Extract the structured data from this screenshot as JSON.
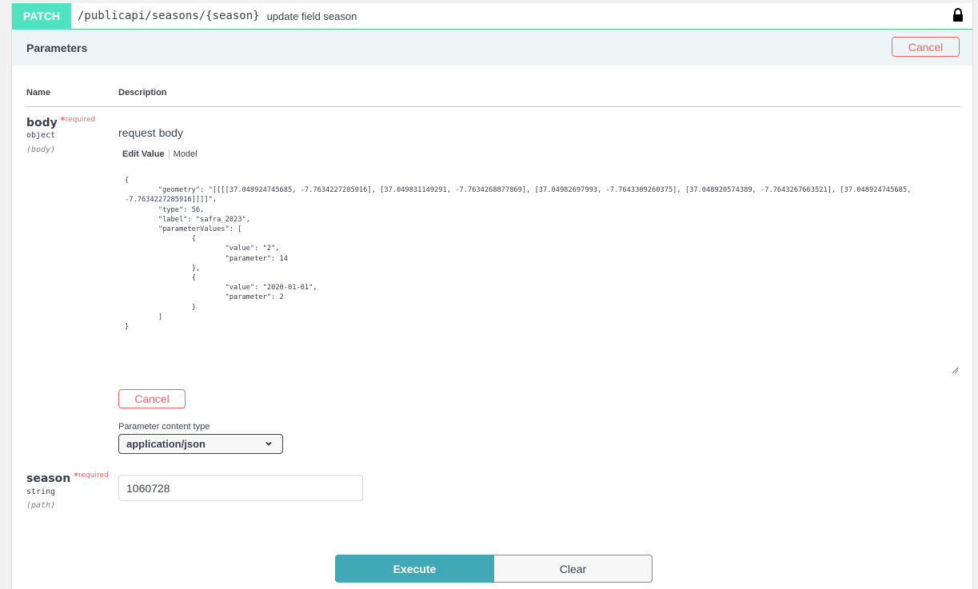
{
  "operation": {
    "method": "PATCH",
    "path": "/publicapi/seasons/{season}",
    "summary": "update field season",
    "lock_icon": "lock-icon"
  },
  "parameters": {
    "title": "Parameters",
    "cancel_label": "Cancel",
    "columns": {
      "name": "Name",
      "description": "Description"
    },
    "body": {
      "name": "body",
      "required_star": "*",
      "required_label": "required",
      "type": "object",
      "in": "(body)",
      "description": "request body",
      "tabs": [
        {
          "label": "Edit Value",
          "active": true
        },
        {
          "label": "Model",
          "active": false
        }
      ],
      "value": "{\n\t\"geometry\": \"[[[[37.048924745685, -7.7634227285916], [37.049831149291, -7.7634268877869], [37.04982697993, -7.7643309260375], [37.048920574389, -7.7643267663521], [37.048924745685, -7.7634227285916]]]]\",\n\t\"type\": 56,\n\t\"label\": \"safra_2023\",\n\t\"parameterValues\": [\n\t\t{\n\t\t\t\"value\": \"2\",\n\t\t\t\"parameter\": 14\n\t\t},\n\t\t{\n\t\t\t\"value\": \"2020-01-01\",\n\t\t\t\"parameter\": 2\n\t\t}\n\t]\n}",
      "cancel_label": "Cancel",
      "content_type_label": "Parameter content type",
      "content_type_value": "application/json"
    },
    "season": {
      "name": "season",
      "required_star": "*",
      "required_label": "required",
      "type": "string",
      "in": "(path)",
      "value": "1060728"
    }
  },
  "actions": {
    "execute_label": "Execute",
    "clear_label": "Clear"
  },
  "colors": {
    "method": "#50e3c2",
    "execute": "#41a9b5",
    "cancel": "#ff6060",
    "params_header_bg": "#edf5f6"
  }
}
